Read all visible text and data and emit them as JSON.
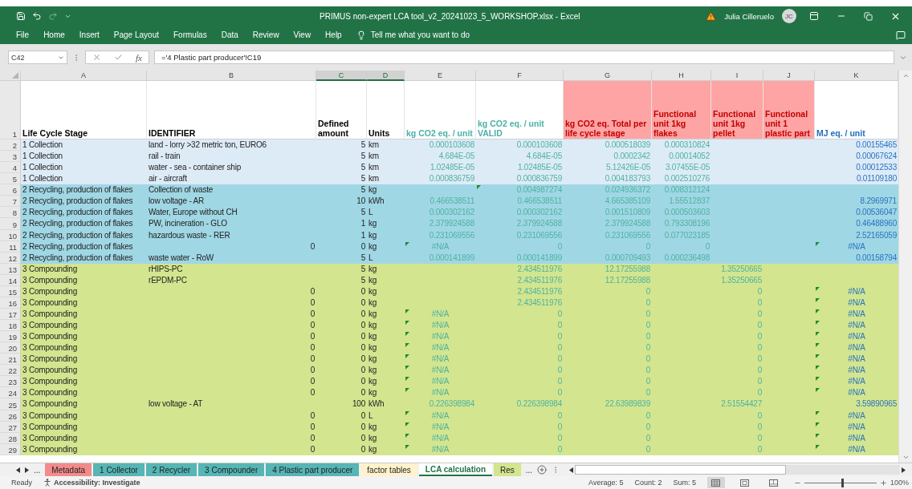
{
  "title_bar": {
    "title": "PRIMUS non-expert LCA tool_v2_20241023_5_WORKSHOP.xlsx  -  Excel",
    "user": "Julia Cilleruelo",
    "avatar_initials": "JC"
  },
  "menu": {
    "items": [
      {
        "label": "File"
      },
      {
        "label": "Home"
      },
      {
        "label": "Insert"
      },
      {
        "label": "Page Layout"
      },
      {
        "label": "Formulas"
      },
      {
        "label": "Data"
      },
      {
        "label": "Review"
      },
      {
        "label": "View"
      },
      {
        "label": "Help"
      }
    ],
    "tell_me": "Tell me what you want to do"
  },
  "formula_bar": {
    "name_box": "C42",
    "function_label": "fx",
    "formula": "='4 Plastic part producer'!C19"
  },
  "columns": [
    {
      "letter": "A",
      "selected": false
    },
    {
      "letter": "B",
      "selected": false
    },
    {
      "letter": "C",
      "selected": true
    },
    {
      "letter": "D",
      "selected": true
    },
    {
      "letter": "E",
      "selected": false
    },
    {
      "letter": "F",
      "selected": false
    },
    {
      "letter": "G",
      "selected": false
    },
    {
      "letter": "H",
      "selected": false
    },
    {
      "letter": "I",
      "selected": false
    },
    {
      "letter": "J",
      "selected": false
    },
    {
      "letter": "K",
      "selected": false
    }
  ],
  "header_row": {
    "number": "1",
    "cells": [
      {
        "text": "Life Cycle Stage",
        "color": "#000000",
        "highlighted": false
      },
      {
        "text": "IDENTIFIER",
        "color": "#000000",
        "highlighted": false
      },
      {
        "text": "Defined amount",
        "color": "#000000",
        "highlighted": false
      },
      {
        "text": "Units",
        "color": "#000000",
        "highlighted": false
      },
      {
        "text": "kg CO2 eq. / unit",
        "color": "#4bb0a8",
        "highlighted": false
      },
      {
        "text": "kg CO2 eq. / unit VALID",
        "color": "#4bb0a8",
        "highlighted": false
      },
      {
        "text": "kg CO2 eq. Total per life cycle stage",
        "color": "#c00000",
        "highlighted": true
      },
      {
        "text": "Functional unit 1kg flakes",
        "color": "#c00000",
        "highlighted": true
      },
      {
        "text": "Functional unit 1kg pellet",
        "color": "#c00000",
        "highlighted": true
      },
      {
        "text": "Functional unit 1 plastic part",
        "color": "#c00000",
        "highlighted": true
      },
      {
        "text": "MJ eq. / unit",
        "color": "#1f6fc0",
        "highlighted": false
      }
    ]
  },
  "rows": [
    {
      "number": "2",
      "color": "#ddebf7",
      "flag_E": false,
      "flag_F": false,
      "flag_K": false,
      "cells": {
        "A": "1 Collection",
        "B": "land - lorry >32 metric ton, EURO6",
        "C": "5",
        "D": "km",
        "E": "0.000103608",
        "F": "0.000103608",
        "G": "0.000518039",
        "H": "0.000310824",
        "K": "0.00155465"
      }
    },
    {
      "number": "3",
      "color": "#ddebf7",
      "flag_E": false,
      "flag_F": false,
      "flag_K": false,
      "cells": {
        "A": "1 Collection",
        "B": "rail - train",
        "C": "5",
        "D": "km",
        "E": "4.684E-05",
        "F": "4.684E-05",
        "G": "0.0002342",
        "H": "0.00014052",
        "K": "0.00067624"
      }
    },
    {
      "number": "4",
      "color": "#ddebf7",
      "flag_E": false,
      "flag_F": false,
      "flag_K": false,
      "cells": {
        "A": "1 Collection",
        "B": "water - sea - container ship",
        "C": "5",
        "D": "km",
        "E": "1.02485E-05",
        "F": "1.02485E-05",
        "G": "5.12426E-05",
        "H": "3.07455E-05",
        "K": "0.00012533"
      }
    },
    {
      "number": "5",
      "color": "#ddebf7",
      "flag_E": false,
      "flag_F": false,
      "flag_K": false,
      "cells": {
        "A": "1 Collection",
        "B": "air - aircraft",
        "C": "5",
        "D": "km",
        "E": "0.000836759",
        "F": "0.000836759",
        "G": "0.004183793",
        "H": "0.002510276",
        "K": "0.01109180"
      }
    },
    {
      "number": "6",
      "color": "#a0d7e5",
      "flag_E": false,
      "flag_F": true,
      "flag_K": false,
      "cells": {
        "A": "2 Recycling, production of flakes",
        "B": "Collection of waste",
        "C": "5",
        "D": "kg",
        "F": "0.004987274",
        "G": "0.024936372",
        "H": "0.008312124"
      }
    },
    {
      "number": "7",
      "color": "#a0d7e5",
      "flag_E": false,
      "flag_F": false,
      "flag_K": false,
      "cells": {
        "A": "2 Recycling, production of flakes",
        "B": "low voltage - AR",
        "C": "10",
        "D": "kWh",
        "E": "0.466538511",
        "F": "0.466538511",
        "G": "4.665385109",
        "H": "1.55512837",
        "K": "8.2969971"
      }
    },
    {
      "number": "8",
      "color": "#a0d7e5",
      "flag_E": false,
      "flag_F": false,
      "flag_K": false,
      "cells": {
        "A": "2 Recycling, production of flakes",
        "B": "Water, Europe without CH",
        "C": "5",
        "D": "L",
        "E": "0.000302162",
        "F": "0.000302162",
        "G": "0.001510809",
        "H": "0.000503603",
        "K": "0.00536047"
      }
    },
    {
      "number": "9",
      "color": "#a0d7e5",
      "flag_E": false,
      "flag_F": false,
      "flag_K": false,
      "cells": {
        "A": "2 Recycling, production of flakes",
        "B": "PW, incineration - GLO",
        "C": "1",
        "D": "kg",
        "E": "2.379924588",
        "F": "2.379924588",
        "G": "2.379924588",
        "H": "0.793308196",
        "K": "0.46488960"
      }
    },
    {
      "number": "10",
      "color": "#a0d7e5",
      "flag_E": false,
      "flag_F": false,
      "flag_K": false,
      "cells": {
        "A": "2 Recycling, production of flakes",
        "B": "hazardous waste - RER",
        "C": "1",
        "D": "kg",
        "E": "0.231069556",
        "F": "0.231069556",
        "G": "0.231069556",
        "H": "0.077023185",
        "K": "2.52165059"
      }
    },
    {
      "number": "11",
      "color": "#a0d7e5",
      "flag_E": true,
      "flag_F": false,
      "flag_K": true,
      "cells": {
        "A": "2 Recycling, production of flakes",
        "B": "0",
        "C": "0",
        "D": "kg",
        "E": "#N/A",
        "F": "0",
        "G": "0",
        "H": "0",
        "K": "#N/A"
      }
    },
    {
      "number": "12",
      "color": "#a0d7e5",
      "flag_E": false,
      "flag_F": false,
      "flag_K": false,
      "cells": {
        "A": "2 Recycling, production of flakes",
        "B": "waste water - RoW",
        "C": "5",
        "D": "L",
        "E": "0.000141899",
        "F": "0.000141899",
        "G": "0.000709493",
        "H": "0.000236498",
        "K": "0.00158794"
      }
    },
    {
      "number": "13",
      "color": "#d3e58f",
      "flag_E": false,
      "flag_F": false,
      "flag_K": false,
      "cells": {
        "A": "3 Compounding",
        "B": "rHIPS-PC",
        "C": "5",
        "D": "kg",
        "F": "2.434511976",
        "G": "12.17255988",
        "I": "1.35250665"
      }
    },
    {
      "number": "14",
      "color": "#d3e58f",
      "flag_E": false,
      "flag_F": false,
      "flag_K": false,
      "cells": {
        "A": "3 Compounding",
        "B": "rEPDM-PC",
        "C": "5",
        "D": "kg",
        "F": "2.434511976",
        "G": "12.17255988",
        "I": "1.35250665"
      }
    },
    {
      "number": "15",
      "color": "#d3e58f",
      "flag_E": false,
      "flag_F": false,
      "flag_K": true,
      "cells": {
        "A": "3 Compounding",
        "B": "0",
        "C": "0",
        "D": "kg",
        "F": "2.434511976",
        "G": "0",
        "I": "0",
        "K": "#N/A"
      }
    },
    {
      "number": "16",
      "color": "#d3e58f",
      "flag_E": false,
      "flag_F": false,
      "flag_K": true,
      "cells": {
        "A": "3 Compounding",
        "B": "0",
        "C": "0",
        "D": "kg",
        "F": "2.434511976",
        "G": "0",
        "I": "0",
        "K": "#N/A"
      }
    },
    {
      "number": "17",
      "color": "#d3e58f",
      "flag_E": true,
      "flag_F": false,
      "flag_K": true,
      "cells": {
        "A": "3 Compounding",
        "B": "0",
        "C": "0",
        "D": "kg",
        "E": "#N/A",
        "F": "0",
        "G": "0",
        "I": "0",
        "K": "#N/A"
      }
    },
    {
      "number": "18",
      "color": "#d3e58f",
      "flag_E": true,
      "flag_F": false,
      "flag_K": true,
      "cells": {
        "A": "3 Compounding",
        "B": "0",
        "C": "0",
        "D": "kg",
        "E": "#N/A",
        "F": "0",
        "G": "0",
        "I": "0",
        "K": "#N/A"
      }
    },
    {
      "number": "19",
      "color": "#d3e58f",
      "flag_E": true,
      "flag_F": false,
      "flag_K": true,
      "cells": {
        "A": "3 Compounding",
        "B": "0",
        "C": "0",
        "D": "kg",
        "E": "#N/A",
        "F": "0",
        "G": "0",
        "I": "0",
        "K": "#N/A"
      }
    },
    {
      "number": "20",
      "color": "#d3e58f",
      "flag_E": true,
      "flag_F": false,
      "flag_K": true,
      "cells": {
        "A": "3 Compounding",
        "B": "0",
        "C": "0",
        "D": "kg",
        "E": "#N/A",
        "F": "0",
        "G": "0",
        "I": "0",
        "K": "#N/A"
      }
    },
    {
      "number": "21",
      "color": "#d3e58f",
      "flag_E": true,
      "flag_F": false,
      "flag_K": true,
      "cells": {
        "A": "3 Compounding",
        "B": "0",
        "C": "0",
        "D": "kg",
        "E": "#N/A",
        "F": "0",
        "G": "0",
        "I": "0",
        "K": "#N/A"
      }
    },
    {
      "number": "22",
      "color": "#d3e58f",
      "flag_E": true,
      "flag_F": false,
      "flag_K": true,
      "cells": {
        "A": "3 Compounding",
        "B": "0",
        "C": "0",
        "D": "kg",
        "E": "#N/A",
        "F": "0",
        "G": "0",
        "I": "0",
        "K": "#N/A"
      }
    },
    {
      "number": "23",
      "color": "#d3e58f",
      "flag_E": true,
      "flag_F": false,
      "flag_K": true,
      "cells": {
        "A": "3 Compounding",
        "B": "0",
        "C": "0",
        "D": "kg",
        "E": "#N/A",
        "F": "0",
        "G": "0",
        "I": "0",
        "K": "#N/A"
      }
    },
    {
      "number": "24",
      "color": "#d3e58f",
      "flag_E": true,
      "flag_F": false,
      "flag_K": true,
      "cells": {
        "A": "3 Compounding",
        "B": "0",
        "C": "0",
        "D": "kg",
        "E": "#N/A",
        "F": "0",
        "G": "0",
        "I": "0",
        "K": "#N/A"
      }
    },
    {
      "number": "25",
      "color": "#d3e58f",
      "flag_E": false,
      "flag_F": false,
      "flag_K": false,
      "cells": {
        "A": "3 Compounding",
        "B": "low voltage - AT",
        "C": "100",
        "D": "kWh",
        "E": "0.226398984",
        "F": "0.226398984",
        "G": "22.63989839",
        "I": "2.51554427",
        "K": "3.59890965"
      }
    },
    {
      "number": "26",
      "color": "#d3e58f",
      "flag_E": true,
      "flag_F": false,
      "flag_K": true,
      "cells": {
        "A": "3 Compounding",
        "B": "0",
        "C": "0",
        "D": "L",
        "E": "#N/A",
        "F": "0",
        "G": "0",
        "I": "0",
        "K": "#N/A"
      }
    },
    {
      "number": "27",
      "color": "#d3e58f",
      "flag_E": true,
      "flag_F": false,
      "flag_K": true,
      "cells": {
        "A": "3 Compounding",
        "B": "0",
        "C": "0",
        "D": "kg",
        "E": "#N/A",
        "F": "0",
        "G": "0",
        "I": "0",
        "K": "#N/A"
      }
    },
    {
      "number": "28",
      "color": "#d3e58f",
      "flag_E": true,
      "flag_F": false,
      "flag_K": true,
      "cells": {
        "A": "3 Compounding",
        "B": "0",
        "C": "0",
        "D": "kg",
        "E": "#N/A",
        "F": "0",
        "G": "0",
        "I": "0",
        "K": "#N/A"
      }
    },
    {
      "number": "29",
      "color": "#d3e58f",
      "flag_E": true,
      "flag_F": false,
      "flag_K": true,
      "cells": {
        "A": "3 Compounding",
        "B": "0",
        "C": "0",
        "D": "kg",
        "E": "#N/A",
        "F": "0",
        "G": "0",
        "I": "0",
        "K": "#N/A"
      }
    }
  ],
  "sheet_tabs": {
    "overflow_left": "...",
    "tabs": [
      {
        "label": "Metadata",
        "color": "#f28b8b",
        "selected": false
      },
      {
        "label": "1 Collector",
        "color": "#56b5b5",
        "selected": false
      },
      {
        "label": "2 Recycler",
        "color": "#56b5b5",
        "selected": false
      },
      {
        "label": "3 Compounder",
        "color": "#56b5b5",
        "selected": false
      },
      {
        "label": "4 Plastic part producer",
        "color": "#56b5b5",
        "selected": false
      },
      {
        "label": "factor tables",
        "color": "#fff2cc",
        "selected": false
      },
      {
        "label": "LCA calculation",
        "color": "#ffffff",
        "selected": true
      },
      {
        "label": "Res",
        "color": "#d3e58f",
        "selected": false
      }
    ],
    "overflow_right": "..."
  },
  "status_bar": {
    "mode": "Ready",
    "accessibility": "Accessibility: Investigate",
    "average": "Average: 5",
    "count": "Count: 2",
    "sum": "Sum: 5",
    "views": [
      {
        "kind": "normal",
        "selected": true
      },
      {
        "kind": "page-layout",
        "selected": false
      },
      {
        "kind": "page-break",
        "selected": false
      }
    ],
    "zoom": {
      "level": 0.52,
      "label": "100%"
    }
  }
}
